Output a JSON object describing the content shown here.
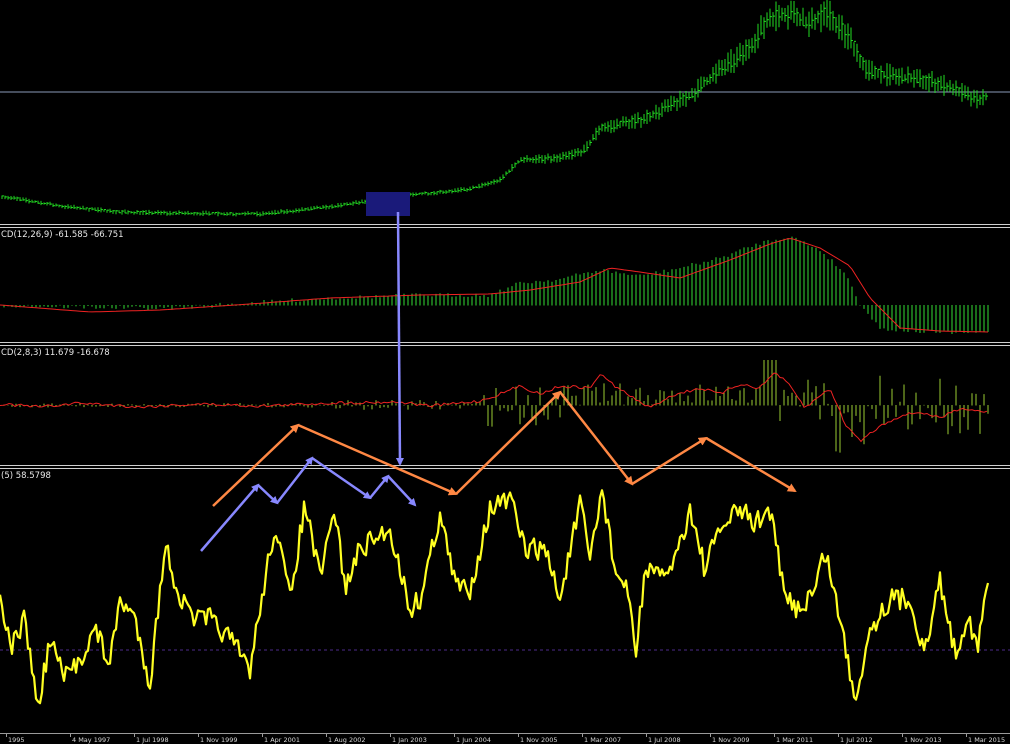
{
  "panes": {
    "price": {
      "level_line_color": "#8a9ab8",
      "bar_color": "#22dd22"
    },
    "macd_slow": {
      "label": "CD(12,26,9) -61.585 -66.751",
      "hist_color": "#33dd33",
      "signal_color": "#ee2222"
    },
    "macd_fast": {
      "label": "CD(2,8,3) 11.679 -16.678",
      "hist_color": "#9acd32",
      "signal_color": "#ee2222"
    },
    "oscillator": {
      "label": "(5) 58.5798",
      "line_color": "#ffff22",
      "level_color": "#4b2a8a"
    }
  },
  "xaxis": {
    "labels": [
      "1995",
      "4 May 1997",
      "1 Jul 1998",
      "1 Nov 1999",
      "1 Apr 2001",
      "1 Aug 2002",
      "1 Jan 2003",
      "1 Jun 2004",
      "1 Nov 2005",
      "1 Mar 2007",
      "1 Jul 2008",
      "1 Nov 2009",
      "1 Mar 2011",
      "1 Jul 2012",
      "1 Nov 2013",
      "1 Mar 2015"
    ]
  },
  "annotations": {
    "highlight_color": "#1a1a7a",
    "blue_arrow_color": "#8888ff",
    "orange_arrow_color": "#ff8844"
  }
}
